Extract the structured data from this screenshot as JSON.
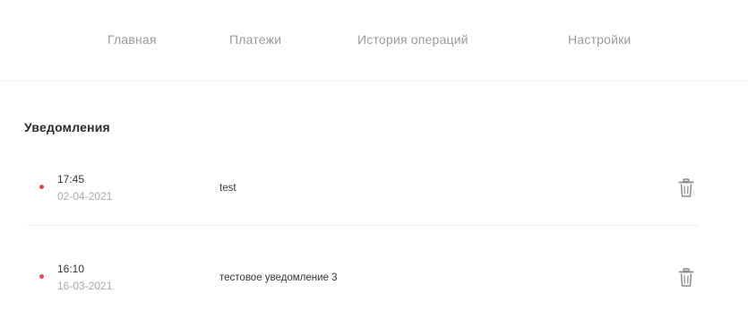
{
  "nav": {
    "items": [
      {
        "label": "Главная"
      },
      {
        "label": "Платежи"
      },
      {
        "label": "История операций"
      },
      {
        "label": "Настройки"
      }
    ]
  },
  "notifications": {
    "title": "Уведомления",
    "items": [
      {
        "time": "17:45",
        "date": "02-04-2021",
        "message": "test",
        "unread_color": "#e0465a",
        "icon": "trash-icon"
      },
      {
        "time": "16:10",
        "date": "16-03-2021",
        "message": "тестовое уведомление 3",
        "unread_color": "#e0465a",
        "icon": "trash-icon"
      }
    ]
  }
}
